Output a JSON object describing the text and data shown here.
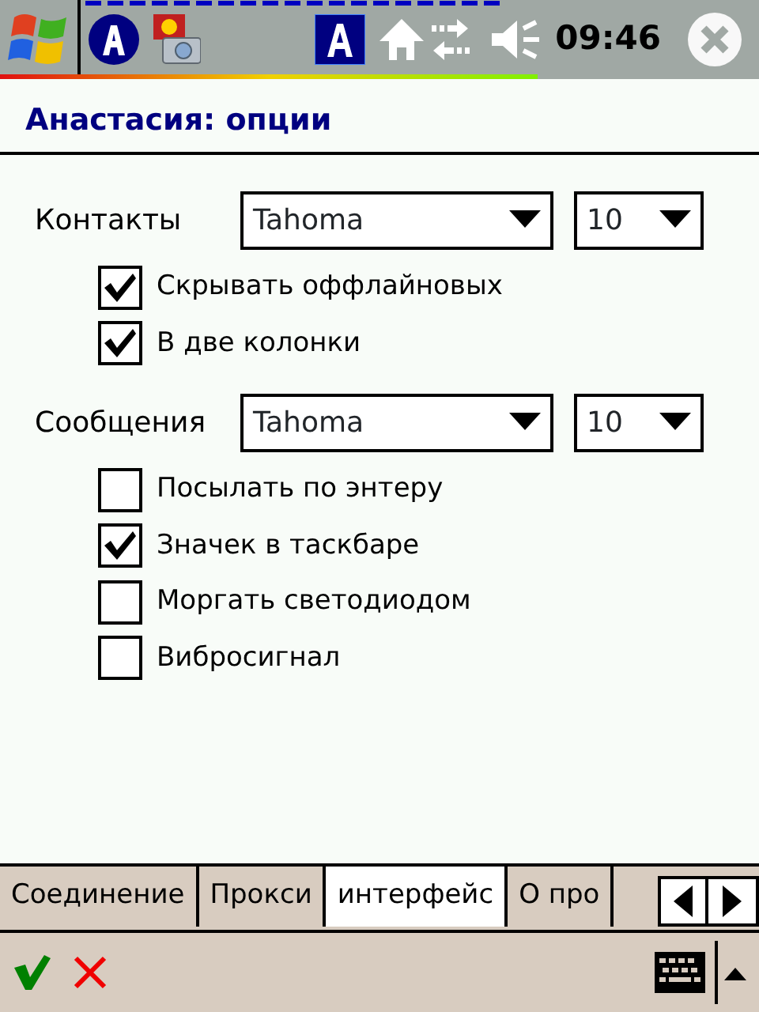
{
  "status_bar": {
    "time": "09:46"
  },
  "title": "Анастасия: опции",
  "sections": [
    {
      "label": "Контакты",
      "font": "Tahoma",
      "size": "10",
      "options": [
        {
          "label": "Скрывать оффлайновых",
          "checked": true
        },
        {
          "label": "В две колонки",
          "checked": true
        }
      ]
    },
    {
      "label": "Сообщения",
      "font": "Tahoma",
      "size": "10",
      "options": [
        {
          "label": "Посылать по энтеру",
          "checked": false
        },
        {
          "label": "Значек в таскбаре",
          "checked": true
        },
        {
          "label": "Моргать светодиодом",
          "checked": false
        },
        {
          "label": "Вибросигнал",
          "checked": false
        }
      ]
    }
  ],
  "tabs": [
    {
      "label": "Соединение",
      "selected": false
    },
    {
      "label": "Прокси",
      "selected": false
    },
    {
      "label": "интерфейс",
      "selected": true
    },
    {
      "label": "О про",
      "selected": false
    }
  ]
}
